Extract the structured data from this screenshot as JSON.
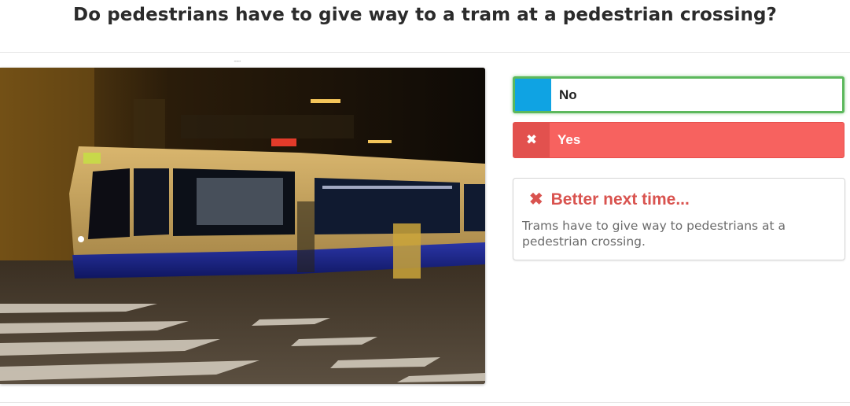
{
  "question": "Do pedestrians have to give way to a tram at a pedestrian crossing?",
  "answers": [
    {
      "label": "No",
      "state": "correct",
      "tag_color": "#0fa3e3",
      "border_color": "#5cb85c"
    },
    {
      "label": "Yes",
      "state": "selected-wrong",
      "tag_icon": "close-icon",
      "tag_glyph": "✖",
      "bg_color": "#f7625f"
    }
  ],
  "feedback": {
    "icon": "close-icon",
    "glyph": "✖",
    "title": "Better next time...",
    "explanation": "Trams have to give way to pedestrians at a pedestrian crossing.",
    "title_color": "#d9534f"
  }
}
